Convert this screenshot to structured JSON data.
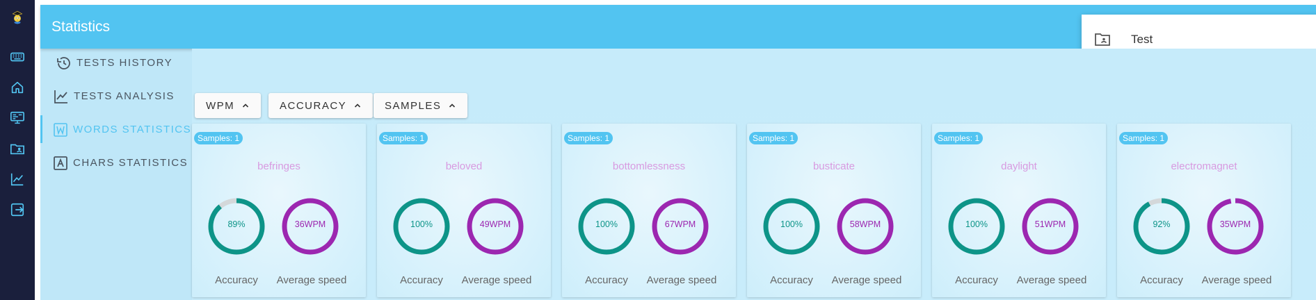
{
  "app": {
    "title": "Statistics"
  },
  "rail": {
    "items": [
      "logo-icon",
      "keyboard-icon",
      "home-icon",
      "monitor-icon",
      "profile-folder-icon",
      "chart-icon",
      "export-icon"
    ]
  },
  "user_select": {
    "selected": "Test"
  },
  "nav": {
    "items": [
      {
        "label": "TESTS HISTORY",
        "icon": "history-icon",
        "active": false
      },
      {
        "label": "TESTS ANALYSIS",
        "icon": "chart-line-icon",
        "active": false
      },
      {
        "label": "WORDS STATISTICS",
        "icon": "word-box-icon",
        "active": true
      },
      {
        "label": "CHARS STATISTICS",
        "icon": "char-box-icon",
        "active": false
      }
    ]
  },
  "sort": {
    "buttons": [
      "WPM",
      "ACCURACY",
      "SAMPLES"
    ]
  },
  "labels": {
    "accuracy": "Accuracy",
    "speed": "Average speed"
  },
  "colors": {
    "accent": "#52c4f1",
    "accuracy": "#0d9488",
    "speed": "#9c27b0",
    "word": "#d89ae0"
  },
  "cards": [
    {
      "samples": "Samples: 1",
      "word": "befringes",
      "accuracy": 89,
      "accuracy_text": "89%",
      "wpm": 36,
      "wpm_text": "36WPM"
    },
    {
      "samples": "Samples: 1",
      "word": "beloved",
      "accuracy": 100,
      "accuracy_text": "100%",
      "wpm": 49,
      "wpm_text": "49WPM"
    },
    {
      "samples": "Samples: 1",
      "word": "bottomlessness",
      "accuracy": 100,
      "accuracy_text": "100%",
      "wpm": 67,
      "wpm_text": "67WPM"
    },
    {
      "samples": "Samples: 1",
      "word": "busticate",
      "accuracy": 100,
      "accuracy_text": "100%",
      "wpm": 58,
      "wpm_text": "58WPM"
    },
    {
      "samples": "Samples: 1",
      "word": "daylight",
      "accuracy": 100,
      "accuracy_text": "100%",
      "wpm": 51,
      "wpm_text": "51WPM"
    },
    {
      "samples": "Samples: 1",
      "word": "electromagnet",
      "accuracy": 92,
      "accuracy_text": "92%",
      "wpm": 35,
      "wpm_text": "35WPM"
    }
  ]
}
